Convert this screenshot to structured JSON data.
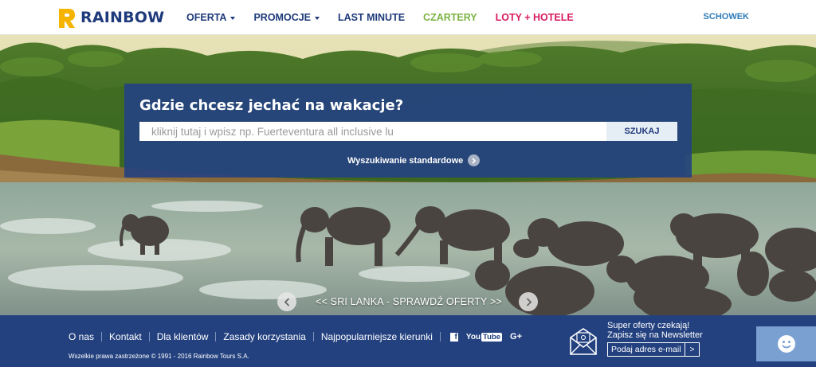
{
  "header": {
    "logo_text": "RAINBOW",
    "nav": [
      {
        "label": "OFERTA",
        "color": "#1e3a7b",
        "has_caret": true
      },
      {
        "label": "PROMOCJE",
        "color": "#1e3a7b",
        "has_caret": true
      },
      {
        "label": "LAST MINUTE",
        "color": "#1e3a7b",
        "has_caret": false
      },
      {
        "label": "CZARTERY",
        "color": "#7cb342",
        "has_caret": false
      },
      {
        "label": "LOTY + HOTELE",
        "color": "#d81b60",
        "has_caret": false
      }
    ],
    "schowek": "SCHOWEK"
  },
  "search": {
    "title": "Gdzie chcesz jechać na wakacje?",
    "placeholder": "kliknij tutaj i wpisz np. Fuerteventura all inclusive lu",
    "button": "SZUKAJ",
    "standard_link": "Wyszukiwanie standardowe"
  },
  "slider": {
    "caption": "<< SRI LANKA - SPRAWDŹ OFERTY >>"
  },
  "footer": {
    "links": [
      "O nas",
      "Kontakt",
      "Dla klientów",
      "Zasady korzystania",
      "Najpopularniejsze kierunki"
    ],
    "social": {
      "facebook": "f",
      "youtube_a": "You",
      "youtube_b": "Tube",
      "google": "G+"
    },
    "copyright": "Wszelkie prawa zastrzeżone © 1991 - 2016 Rainbow Tours S.A.",
    "newsletter": {
      "line1": "Super oferty czekają!",
      "line2": "Zapisz się na Newsletter",
      "placeholder": "Podaj adres e-mail",
      "button": ">"
    }
  },
  "colors": {
    "brand_navy": "#1e3a7b",
    "footer_bg": "#23417f",
    "logo_yellow": "#f5b400",
    "czartery_green": "#7cb342",
    "loty_pink": "#d81b60"
  },
  "icons": {
    "chat": "smiley-icon",
    "newsletter": "envelope-icon"
  }
}
